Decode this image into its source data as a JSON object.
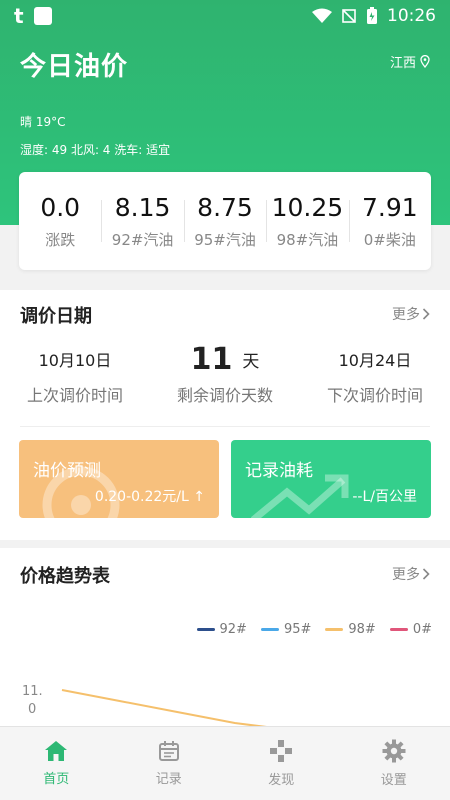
{
  "status_bar": {
    "time": "10:26"
  },
  "header": {
    "title": "今日油价",
    "location": "江西",
    "weather": "晴 19°C",
    "details": "湿度: 49  北风: 4  洗车: 适宜"
  },
  "prices": [
    {
      "value": "0.0",
      "label": "涨跌"
    },
    {
      "value": "8.15",
      "label": "92#汽油"
    },
    {
      "value": "8.75",
      "label": "95#汽油"
    },
    {
      "value": "10.25",
      "label": "98#汽油"
    },
    {
      "value": "7.91",
      "label": "0#柴油"
    }
  ],
  "adjust": {
    "title": "调价日期",
    "more": "更多",
    "last_date": "10月10日",
    "last_label": "上次调价时间",
    "remaining_value": "11",
    "remaining_unit": "天",
    "remaining_label": "剩余调价天数",
    "next_date": "10月24日",
    "next_label": "下次调价时间"
  },
  "actions": {
    "forecast_title": "油价预测",
    "forecast_value": "0.20-0.22元/L ↑",
    "record_title": "记录油耗",
    "record_value": "--L/百公里"
  },
  "trend": {
    "title": "价格趋势表",
    "more": "更多",
    "legend": [
      {
        "name": "92#",
        "color": "#2d4f8c"
      },
      {
        "name": "95#",
        "color": "#4aa8e8"
      },
      {
        "name": "98#",
        "color": "#f5c06c"
      },
      {
        "name": "0#",
        "color": "#e0567a"
      }
    ],
    "y_tick_line1": "11.",
    "y_tick_line2": "0"
  },
  "chart_data": {
    "type": "line",
    "title": "价格趋势表",
    "series": [
      {
        "name": "98#",
        "values": [
          11.0,
          10.85,
          10.7,
          10.55,
          10.45,
          10.4
        ]
      }
    ],
    "y_tick_visible": "11.0"
  },
  "tabs": [
    {
      "label": "首页",
      "icon": "home-icon",
      "active": true
    },
    {
      "label": "记录",
      "icon": "calendar-icon",
      "active": false
    },
    {
      "label": "发现",
      "icon": "discover-icon",
      "active": false
    },
    {
      "label": "设置",
      "icon": "gear-icon",
      "active": false
    }
  ],
  "colors": {
    "brand": "#2ec47c",
    "forecast_card": "#f7c07d",
    "record_card": "#34cf8c",
    "tab_active": "#2db874"
  }
}
